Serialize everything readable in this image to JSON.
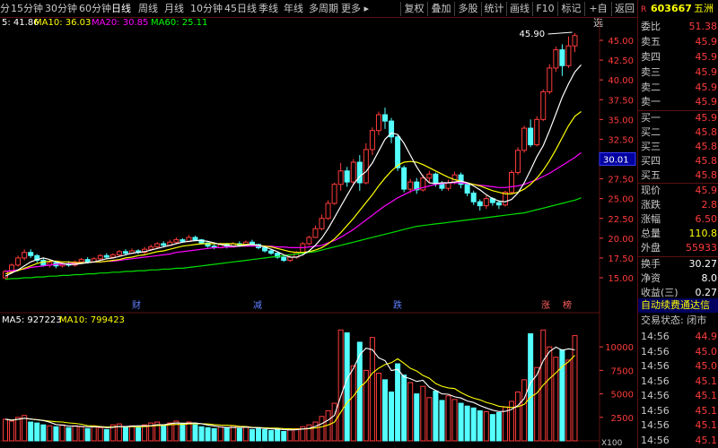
{
  "toolbar": {
    "timeframes": [
      "分",
      "15分钟",
      "30分钟",
      "60分钟",
      "日线",
      "周线",
      "月线",
      "10分钟",
      "45日线",
      "季线",
      "年线",
      "多周期",
      "更多 ▸"
    ],
    "active_timeframe": "日线",
    "buttons": [
      "复权",
      "叠加",
      "多股",
      "统计",
      "画线",
      "F10",
      "标记",
      "+自选",
      "返回"
    ]
  },
  "ma_legend": {
    "price": [
      {
        "text": "5: 41.86",
        "color": "#ffffff"
      },
      {
        "text": "MA10: 36.03",
        "color": "#ffff00"
      },
      {
        "text": "MA20: 30.85",
        "color": "#ff00ff"
      },
      {
        "text": "MA60: 25.11",
        "color": "#00ff00"
      }
    ],
    "volume": [
      {
        "text": "MA5: 927223",
        "color": "#ffffff"
      },
      {
        "text": "MA10: 799423",
        "color": "#ffff00"
      }
    ]
  },
  "price_axis": [
    "45.00",
    "42.50",
    "40.00",
    "37.50",
    "35.00",
    "32.50",
    "30.00",
    "27.50",
    "25.00",
    "22.50",
    "20.00",
    "17.50",
    "15.00"
  ],
  "crosshair_price": "30.01",
  "high_marker": "45.90",
  "volume_axis": [
    "10000",
    "7500",
    "5000",
    "2500"
  ],
  "volume_unit": "X100",
  "event_markers": [
    "财",
    "减",
    "跌",
    "涨",
    "榜"
  ],
  "chart_data": {
    "type": "candlestick",
    "ylim": [
      14.0,
      46.5
    ],
    "candles": [
      [
        15.0,
        15.8,
        14.8,
        16.0
      ],
      [
        15.8,
        16.6,
        15.5,
        16.8
      ],
      [
        16.6,
        17.5,
        16.4,
        17.8
      ],
      [
        17.5,
        18.2,
        17.2,
        18.6
      ],
      [
        18.2,
        17.8,
        17.5,
        18.6
      ],
      [
        17.8,
        17.2,
        16.9,
        18.0
      ],
      [
        17.2,
        16.6,
        16.4,
        17.5
      ],
      [
        16.6,
        16.9,
        16.3,
        17.2
      ],
      [
        16.9,
        16.5,
        16.2,
        17.1
      ],
      [
        16.5,
        16.8,
        16.3,
        17.0
      ],
      [
        16.8,
        16.6,
        16.4,
        17.1
      ],
      [
        16.6,
        17.0,
        16.4,
        17.2
      ],
      [
        17.0,
        17.3,
        16.8,
        17.5
      ],
      [
        17.3,
        17.0,
        16.8,
        17.6
      ],
      [
        17.0,
        17.4,
        16.9,
        17.6
      ],
      [
        17.4,
        17.8,
        17.2,
        18.0
      ],
      [
        17.8,
        17.6,
        17.4,
        18.1
      ],
      [
        17.6,
        17.9,
        17.4,
        18.1
      ],
      [
        17.9,
        18.3,
        17.7,
        18.5
      ],
      [
        18.3,
        18.1,
        17.9,
        18.6
      ],
      [
        18.1,
        18.4,
        18.0,
        18.7
      ],
      [
        18.4,
        18.2,
        18.0,
        18.6
      ],
      [
        18.2,
        18.6,
        18.0,
        18.9
      ],
      [
        18.6,
        18.9,
        18.4,
        19.2
      ],
      [
        18.9,
        19.3,
        18.7,
        19.5
      ],
      [
        19.3,
        19.1,
        18.9,
        19.6
      ],
      [
        19.1,
        19.5,
        19.0,
        19.8
      ],
      [
        19.5,
        19.8,
        19.3,
        20.1
      ],
      [
        19.8,
        19.6,
        19.4,
        20.0
      ],
      [
        19.6,
        20.1,
        19.5,
        20.4
      ],
      [
        20.1,
        19.8,
        19.6,
        20.3
      ],
      [
        19.8,
        19.4,
        19.2,
        19.9
      ],
      [
        19.4,
        19.0,
        18.8,
        19.5
      ],
      [
        19.0,
        18.8,
        18.6,
        19.2
      ],
      [
        18.8,
        19.2,
        18.7,
        19.4
      ],
      [
        19.2,
        18.9,
        18.7,
        19.4
      ],
      [
        18.9,
        19.3,
        18.8,
        19.5
      ],
      [
        19.3,
        19.1,
        18.9,
        19.6
      ],
      [
        19.1,
        19.5,
        19.0,
        19.7
      ],
      [
        19.5,
        19.2,
        19.0,
        19.8
      ],
      [
        19.2,
        18.8,
        18.6,
        19.3
      ],
      [
        18.8,
        18.4,
        18.2,
        18.9
      ],
      [
        18.4,
        18.1,
        17.9,
        18.6
      ],
      [
        18.1,
        17.6,
        17.4,
        18.2
      ],
      [
        17.6,
        17.2,
        17.0,
        17.8
      ],
      [
        17.2,
        17.6,
        17.0,
        17.8
      ],
      [
        17.6,
        18.2,
        17.4,
        18.4
      ],
      [
        18.2,
        19.3,
        18.0,
        19.5
      ],
      [
        19.3,
        20.1,
        19.1,
        20.3
      ],
      [
        20.1,
        21.2,
        20.0,
        21.6
      ],
      [
        21.2,
        22.5,
        21.0,
        23.0
      ],
      [
        22.5,
        24.4,
        22.3,
        24.8
      ],
      [
        24.4,
        26.8,
        24.2,
        27.0
      ],
      [
        26.8,
        28.5,
        26.0,
        29.5
      ],
      [
        28.5,
        27.1,
        26.5,
        29.0
      ],
      [
        27.1,
        29.6,
        26.8,
        30.0
      ],
      [
        29.6,
        27.0,
        26.0,
        30.5
      ],
      [
        27.0,
        31.2,
        26.8,
        32.0
      ],
      [
        31.2,
        33.6,
        30.5,
        34.0
      ],
      [
        33.6,
        35.6,
        33.0,
        36.0
      ],
      [
        35.6,
        34.8,
        33.8,
        36.5
      ],
      [
        34.8,
        32.8,
        32.0,
        35.2
      ],
      [
        32.8,
        28.9,
        28.5,
        33.0
      ],
      [
        28.9,
        26.2,
        25.8,
        29.2
      ],
      [
        26.2,
        27.1,
        25.7,
        27.5
      ],
      [
        27.1,
        26.1,
        25.6,
        27.6
      ],
      [
        26.1,
        27.6,
        25.9,
        28.0
      ],
      [
        27.6,
        28.1,
        27.0,
        28.5
      ],
      [
        28.1,
        26.9,
        26.5,
        28.3
      ],
      [
        26.9,
        26.3,
        26.0,
        27.2
      ],
      [
        26.3,
        27.0,
        26.0,
        27.4
      ],
      [
        27.0,
        28.0,
        26.8,
        28.4
      ],
      [
        28.0,
        26.8,
        26.3,
        28.3
      ],
      [
        26.8,
        25.7,
        25.3,
        27.0
      ],
      [
        25.7,
        24.6,
        24.2,
        26.0
      ],
      [
        24.6,
        24.1,
        23.5,
        24.9
      ],
      [
        24.1,
        25.0,
        23.7,
        25.4
      ],
      [
        25.0,
        24.5,
        24.1,
        25.2
      ],
      [
        24.5,
        24.2,
        23.7,
        24.8
      ],
      [
        24.2,
        25.8,
        24.0,
        26.0
      ],
      [
        25.8,
        28.3,
        25.6,
        28.6
      ],
      [
        28.3,
        31.1,
        28.0,
        31.5
      ],
      [
        31.1,
        33.9,
        30.8,
        34.2
      ],
      [
        33.9,
        31.8,
        31.5,
        35.0
      ],
      [
        31.8,
        35.0,
        31.6,
        35.4
      ],
      [
        35.0,
        38.5,
        34.8,
        38.8
      ],
      [
        38.5,
        41.5,
        38.2,
        42.0
      ],
      [
        41.5,
        43.8,
        41.0,
        44.2
      ],
      [
        43.8,
        41.8,
        40.5,
        44.5
      ],
      [
        41.8,
        44.3,
        41.5,
        45.5
      ],
      [
        44.3,
        45.6,
        43.5,
        45.9
      ]
    ],
    "ma5": [
      15.2,
      15.6,
      16.0,
      16.5,
      17.0,
      17.3,
      17.5,
      17.3,
      17.0,
      16.8,
      16.7,
      16.7,
      16.8,
      16.9,
      17.0,
      17.2,
      17.4,
      17.5,
      17.7,
      17.9,
      18.1,
      18.2,
      18.3,
      18.5,
      18.7,
      18.9,
      19.1,
      19.3,
      19.5,
      19.6,
      19.7,
      19.7,
      19.6,
      19.4,
      19.2,
      19.1,
      19.0,
      19.0,
      19.1,
      19.2,
      19.1,
      18.9,
      18.6,
      18.3,
      17.9,
      17.6,
      17.6,
      17.9,
      18.4,
      19.1,
      20.0,
      21.2,
      22.6,
      24.0,
      25.4,
      26.8,
      27.8,
      28.4,
      29.5,
      31.0,
      32.5,
      33.3,
      33.1,
      32.0,
      30.5,
      29.0,
      27.8,
      27.0,
      26.9,
      27.0,
      27.0,
      27.1,
      27.2,
      27.0,
      26.6,
      26.1,
      25.5,
      25.0,
      24.7,
      24.6,
      24.9,
      25.7,
      27.0,
      28.6,
      30.3,
      31.7,
      33.6,
      35.7,
      37.8,
      39.5,
      41.0,
      41.9
    ],
    "ma10": [
      15.5,
      15.7,
      15.9,
      16.2,
      16.5,
      16.8,
      17.0,
      17.1,
      17.1,
      17.0,
      17.0,
      16.9,
      16.9,
      16.9,
      17.0,
      17.0,
      17.1,
      17.2,
      17.3,
      17.5,
      17.6,
      17.8,
      17.9,
      18.1,
      18.3,
      18.4,
      18.6,
      18.8,
      19.0,
      19.1,
      19.2,
      19.3,
      19.3,
      19.3,
      19.3,
      19.3,
      19.3,
      19.2,
      19.2,
      19.2,
      19.1,
      19.0,
      18.9,
      18.7,
      18.5,
      18.3,
      18.2,
      18.2,
      18.3,
      18.5,
      18.8,
      19.3,
      19.9,
      20.7,
      21.6,
      22.5,
      23.5,
      24.5,
      25.5,
      26.6,
      27.6,
      28.5,
      29.2,
      29.6,
      29.7,
      29.6,
      29.3,
      28.9,
      28.5,
      28.1,
      27.7,
      27.4,
      27.2,
      27.0,
      26.8,
      26.6,
      26.3,
      26.0,
      25.8,
      25.6,
      25.6,
      25.8,
      26.2,
      26.8,
      27.6,
      28.6,
      29.8,
      31.2,
      32.7,
      34.2,
      35.4,
      36.0
    ],
    "ma20": [
      15.8,
      15.9,
      16.0,
      16.1,
      16.3,
      16.4,
      16.5,
      16.6,
      16.7,
      16.7,
      16.8,
      16.8,
      16.9,
      16.9,
      17.0,
      17.0,
      17.1,
      17.1,
      17.2,
      17.3,
      17.4,
      17.5,
      17.6,
      17.7,
      17.8,
      17.9,
      18.0,
      18.2,
      18.3,
      18.4,
      18.5,
      18.6,
      18.7,
      18.8,
      18.8,
      18.9,
      18.9,
      19.0,
      19.0,
      19.0,
      19.0,
      19.0,
      19.0,
      18.9,
      18.9,
      18.8,
      18.8,
      18.8,
      18.9,
      19.0,
      19.1,
      19.4,
      19.7,
      20.1,
      20.6,
      21.1,
      21.7,
      22.3,
      22.9,
      23.5,
      24.1,
      24.6,
      25.1,
      25.5,
      25.9,
      26.2,
      26.4,
      26.6,
      26.8,
      26.9,
      27.0,
      27.0,
      27.0,
      26.9,
      26.8,
      26.7,
      26.6,
      26.5,
      26.4,
      26.4,
      26.5,
      26.6,
      26.8,
      27.1,
      27.4,
      27.8,
      28.2,
      28.7,
      29.2,
      29.7,
      30.2,
      30.8
    ],
    "ma60": [
      14.8,
      14.9,
      14.9,
      15.0,
      15.0,
      15.1,
      15.1,
      15.2,
      15.2,
      15.3,
      15.3,
      15.4,
      15.4,
      15.5,
      15.5,
      15.6,
      15.6,
      15.7,
      15.7,
      15.8,
      15.8,
      15.9,
      15.9,
      16.0,
      16.0,
      16.1,
      16.1,
      16.2,
      16.2,
      16.3,
      16.4,
      16.5,
      16.6,
      16.7,
      16.8,
      16.9,
      17.0,
      17.1,
      17.2,
      17.3,
      17.4,
      17.5,
      17.6,
      17.7,
      17.8,
      17.9,
      18.0,
      18.1,
      18.2,
      18.3,
      18.5,
      18.7,
      18.9,
      19.1,
      19.3,
      19.5,
      19.7,
      19.9,
      20.1,
      20.3,
      20.5,
      20.7,
      20.9,
      21.1,
      21.3,
      21.5,
      21.6,
      21.7,
      21.8,
      21.9,
      22.0,
      22.1,
      22.2,
      22.3,
      22.4,
      22.5,
      22.6,
      22.7,
      22.8,
      22.9,
      23.0,
      23.1,
      23.2,
      23.4,
      23.6,
      23.8,
      24.0,
      24.2,
      24.4,
      24.6,
      24.8,
      25.1
    ],
    "volume": [
      2300,
      2100,
      2500,
      2700,
      2000,
      1900,
      1700,
      1600,
      1500,
      1700,
      1400,
      1600,
      1500,
      1300,
      1600,
      1400,
      1200,
      1700,
      1800,
      1500,
      1600,
      1400,
      1700,
      1900,
      2000,
      1600,
      1900,
      2100,
      1800,
      2000,
      1700,
      1500,
      1400,
      1300,
      1500,
      1400,
      1600,
      1300,
      1500,
      1200,
      1400,
      1200,
      1100,
      1300,
      1000,
      1200,
      1300,
      1500,
      1700,
      2000,
      2600,
      3200,
      4000,
      11800,
      11500,
      8000,
      10500,
      7500,
      11000,
      7200,
      6500,
      5200,
      8200,
      7000,
      6200,
      5000,
      5800,
      4600,
      5300,
      4300,
      4800,
      4400,
      4000,
      3700,
      3500,
      3200,
      3100,
      2800,
      3000,
      3600,
      4200,
      5200,
      6500,
      11400,
      7800,
      11800,
      10000,
      8900,
      9700,
      8600,
      11200
    ]
  },
  "panel": {
    "code": "603667",
    "name": "五洲",
    "rows": [
      {
        "label": "委比",
        "value": "51.38",
        "color": "red"
      },
      {
        "label": "卖五",
        "value": "45.9",
        "color": "red"
      },
      {
        "label": "卖四",
        "value": "45.9",
        "color": "red"
      },
      {
        "label": "卖三",
        "value": "45.9",
        "color": "red"
      },
      {
        "label": "卖二",
        "value": "45.9",
        "color": "red"
      },
      {
        "label": "卖一",
        "value": "45.9",
        "color": "red"
      },
      {
        "label": "买一",
        "value": "45.9",
        "color": "red"
      },
      {
        "label": "买二",
        "value": "45.8",
        "color": "red"
      },
      {
        "label": "买三",
        "value": "45.8",
        "color": "red"
      },
      {
        "label": "买四",
        "value": "45.8",
        "color": "red"
      },
      {
        "label": "买五",
        "value": "45.8",
        "color": "red"
      },
      {
        "label": "现价",
        "value": "45.9",
        "color": "red"
      },
      {
        "label": "涨跌",
        "value": "2.8",
        "color": "red"
      },
      {
        "label": "涨幅",
        "value": "6.50",
        "color": "red"
      },
      {
        "label": "总量",
        "value": "110.8",
        "color": "yellow"
      },
      {
        "label": "外盘",
        "value": "55933",
        "color": "red"
      },
      {
        "label": "换手",
        "value": "30.27",
        "color": "white"
      },
      {
        "label": "净资",
        "value": "8.0",
        "color": "white"
      },
      {
        "label": "收益(三)",
        "value": "0.27",
        "color": "white"
      }
    ],
    "banner": "自动续费通达信",
    "trade_status": "交易状态: 闭市",
    "ticks": [
      {
        "time": "14:56",
        "price": "44.9"
      },
      {
        "time": "14:56",
        "price": "45.0"
      },
      {
        "time": "14:56",
        "price": "45.0"
      },
      {
        "time": "14:56",
        "price": "45.1"
      },
      {
        "time": "14:56",
        "price": "45.1"
      },
      {
        "time": "14:56",
        "price": "45.1"
      },
      {
        "time": "14:56",
        "price": "45.1"
      },
      {
        "time": "14:56",
        "price": "45.1"
      }
    ]
  }
}
